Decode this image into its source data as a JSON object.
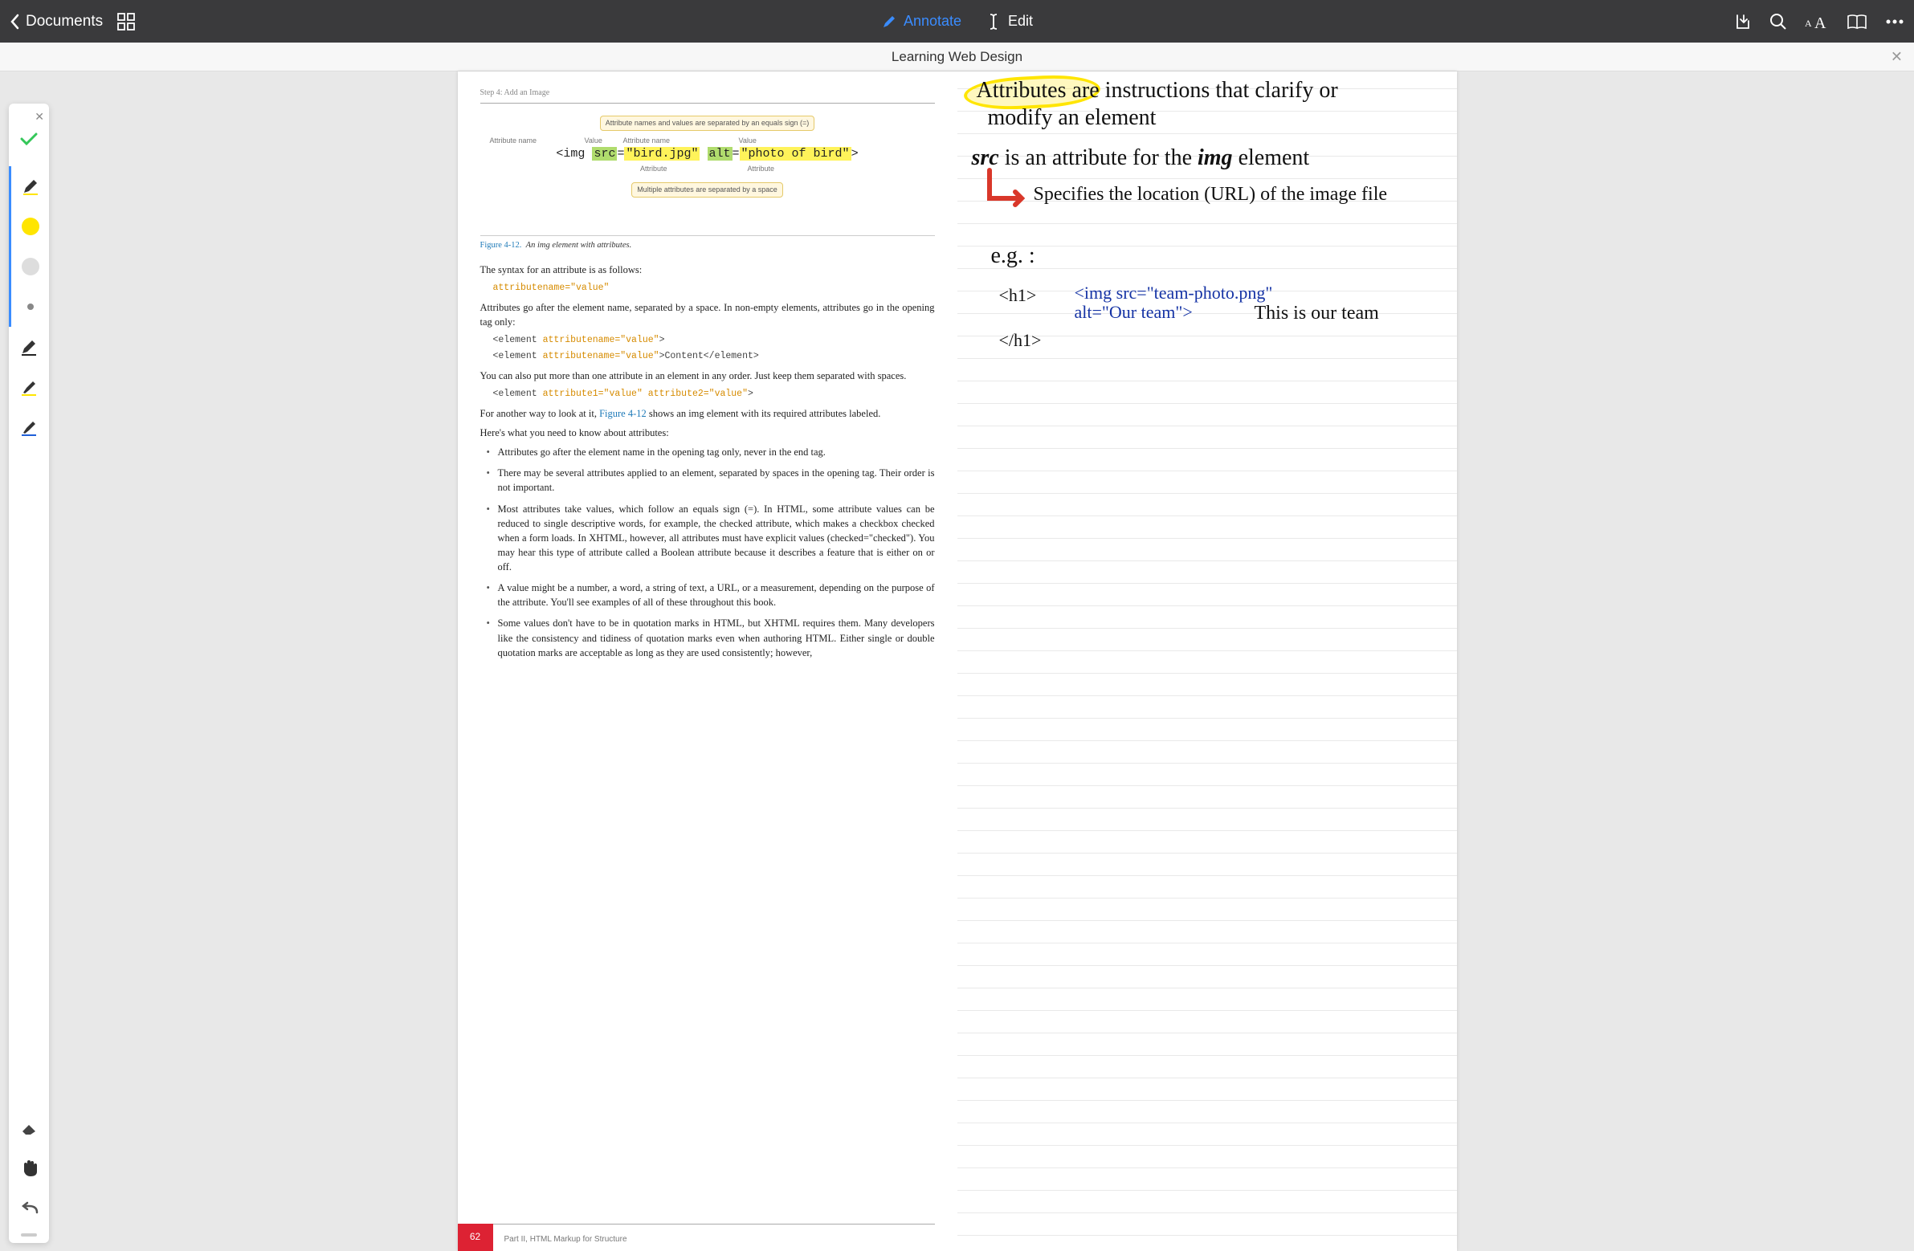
{
  "toolbar": {
    "back_label": "Documents",
    "annotate_label": "Annotate",
    "edit_label": "Edit"
  },
  "document_title": "Learning Web Design",
  "page": {
    "step_header": "Step 4: Add an Image",
    "fig": {
      "callout_top": "Attribute names and values are separated by an equals sign (=)",
      "label_attrname": "Attribute name",
      "label_value": "Value",
      "code_prefix": "<img ",
      "src_name": "src",
      "src_val": "\"bird.jpg\"",
      "alt_name": "alt",
      "alt_val": "\"photo of bird\"",
      "code_suffix": ">",
      "label_attribute": "Attribute",
      "callout_bottom": "Multiple attributes are separated by a space"
    },
    "fig_caption_num": "Figure 4-12.",
    "fig_caption_text": "An img element with attributes.",
    "p_syntax": "The syntax for an attribute is as follows:",
    "code_syntax": "attributename=\"value\"",
    "p_after1": "Attributes go after the element name, separated by a space. In non-empty elements, attributes go in the opening tag only:",
    "code_block1_a": "<element ",
    "code_block1_b": "attributename=\"value\"",
    "code_block1_c": ">",
    "code_block2_a": "<element ",
    "code_block2_b": "attributename=\"value\"",
    "code_block2_c": ">Content</element>",
    "p_after2": "You can also put more than one attribute in an element in any order. Just keep them separated with spaces.",
    "code_block3_a": "<element ",
    "code_block3_b": "attribute1=\"value\"",
    "code_block3_c": " ",
    "code_block3_d": "attribute2=\"value\"",
    "code_block3_e": ">",
    "p_figref_a": "For another way to look at it, ",
    "p_figref_link": "Figure 4-12",
    "p_figref_b": " shows an img element with its required attributes labeled.",
    "p_know": "Here's what you need to know about attributes:",
    "bullets": [
      "Attributes go after the element name in the opening tag only, never in the end tag.",
      "There may be several attributes applied to an element, separated by spaces in the opening tag. Their order is not important.",
      "Most attributes take values, which follow an equals sign (=). In HTML, some attribute values can be reduced to single descriptive words, for example, the checked attribute, which makes a checkbox checked when a form loads. In XHTML, however, all attributes must have explicit values (checked=\"checked\"). You may hear this type of attribute called a Boolean attribute because it describes a feature that is either on or off.",
      "A value might be a number, a word, a string of text, a URL, or a measurement, depending on the purpose of the attribute. You'll see examples of all of these throughout this book.",
      "Some values don't have to be in quotation marks in HTML, but XHTML requires them. Many developers like the consistency and tidiness of quotation marks even when authoring HTML. Either single or double quotation marks are acceptable as long as they are used consistently; however,"
    ],
    "page_number": "62",
    "part_label": "Part  II, HTML Markup for Structure"
  },
  "notes": {
    "line1": "Attributes are instructions that clarify or",
    "line2": "modify an element",
    "line3a": "src",
    "line3b": " is an attribute for the ",
    "line3c": "img",
    "line3d": " element",
    "line4": "Specifies the location (URL) of the image file",
    "line5": "e.g. :",
    "line6": "<h1>",
    "line6b": "<img src=\"team-photo.png\" alt=\"Our team\">",
    "line6c": "This is our team",
    "line7": "</h1>"
  }
}
